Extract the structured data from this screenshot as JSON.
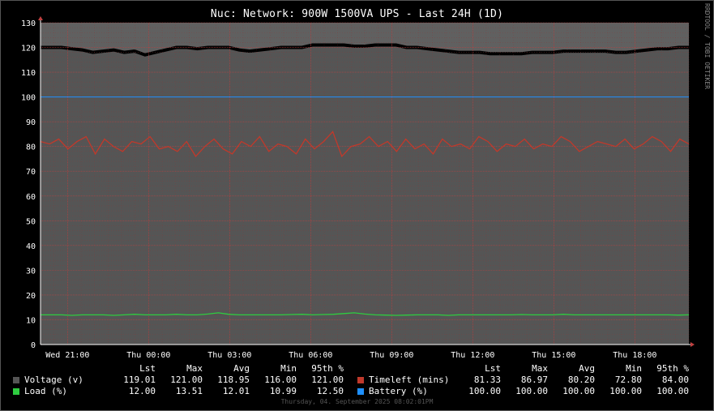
{
  "window": {
    "title": "Nuc: Network: 900W 1500VA UPS - Last 24H (1D)",
    "side_label": "RRDTOOL / TOBI OETIKER",
    "footer": "Thursday, 04. September 2025 08:02:01PM"
  },
  "colors": {
    "background": "#000000",
    "plot": "#606060",
    "grid": "#ff0000",
    "voltage": "#000000",
    "timeleft": "#c0392b",
    "load": "#2ecc40",
    "battery": "#1e90ff"
  },
  "chart_data": {
    "type": "line",
    "title": "Nuc: Network: 900W 1500VA UPS - Last 24H (1D)",
    "ylim": [
      0,
      130
    ],
    "yticks": [
      "0",
      "10",
      "20",
      "30",
      "40",
      "50",
      "60",
      "70",
      "80",
      "90",
      "100",
      "110",
      "120",
      "130"
    ],
    "xticks": [
      "Wed 21:00",
      "Thu 00:00",
      "Thu 03:00",
      "Thu 06:00",
      "Thu 09:00",
      "Thu 12:00",
      "Thu 15:00",
      "Thu 18:00"
    ],
    "x_hours": [
      1,
      4,
      7,
      10,
      13,
      16,
      19,
      22
    ],
    "grid": true,
    "legend": "bottom",
    "legend_headers": [
      "Lst",
      "Max",
      "Avg",
      "Min",
      "95th %"
    ],
    "series": [
      {
        "name": "Voltage (v)",
        "kind": "area",
        "color": "#555555",
        "stats": [
          "119.01",
          "121.00",
          "118.95",
          "116.00",
          "121.00"
        ],
        "values": [
          120,
          120,
          120,
          119.5,
          119,
          118,
          118.5,
          119,
          118,
          118.5,
          117,
          118,
          119,
          120,
          120,
          119.5,
          120,
          120,
          120,
          119,
          118.5,
          119,
          119.5,
          120,
          120,
          120,
          121,
          121,
          121,
          121,
          120.5,
          120.5,
          121,
          121,
          121,
          120,
          120,
          119.5,
          119,
          118.5,
          118,
          118,
          118,
          117.5,
          117.5,
          117.5,
          117.5,
          118,
          118,
          118,
          118.5,
          118.5,
          118.5,
          118.5,
          118.5,
          118,
          118,
          118.5,
          119,
          119.5,
          119.5,
          120,
          120
        ]
      },
      {
        "name": "Load (%)",
        "kind": "line",
        "color": "#2ecc40",
        "stats": [
          "12.00",
          "13.51",
          "12.01",
          "10.99",
          "12.50"
        ],
        "values": [
          12,
          12,
          12,
          11.8,
          12,
          12,
          12,
          11.8,
          12,
          12.2,
          12,
          12,
          12,
          12.2,
          12,
          12,
          12.3,
          12.8,
          12.2,
          12,
          12,
          12,
          12,
          12,
          12.1,
          12.2,
          12,
          12.1,
          12.2,
          12.5,
          12.8,
          12.3,
          12,
          11.9,
          11.8,
          11.9,
          12,
          12,
          12,
          11.8,
          12,
          12,
          12,
          12,
          12,
          12,
          12.1,
          12,
          12,
          12,
          12.2,
          12,
          12,
          12,
          12,
          12,
          12,
          12,
          12,
          12,
          12,
          11.9,
          12
        ]
      },
      {
        "name": "Timeleft (mins)",
        "kind": "line",
        "color": "#c0392b",
        "stats": [
          "81.33",
          "86.97",
          "80.20",
          "72.80",
          "84.00"
        ],
        "values": [
          82,
          81,
          83,
          79,
          82,
          84,
          77,
          83,
          80,
          78,
          82,
          81,
          84,
          79,
          80,
          78,
          82,
          76,
          80,
          83,
          79,
          77,
          82,
          80,
          84,
          78,
          81,
          80,
          77,
          83,
          79,
          82,
          86,
          76,
          80,
          81,
          84,
          80,
          82,
          78,
          83,
          79,
          81,
          77,
          83,
          80,
          81,
          79,
          84,
          82,
          78,
          81,
          80,
          83,
          79,
          81,
          80,
          84,
          82,
          78,
          80,
          82,
          81,
          80,
          83,
          79,
          81,
          84,
          82,
          78,
          83,
          81
        ]
      },
      {
        "name": "Battery (%)",
        "kind": "line",
        "color": "#1e90ff",
        "stats": [
          "100.00",
          "100.00",
          "100.00",
          "100.00",
          "100.00"
        ],
        "values": [
          100,
          100,
          100,
          100,
          100,
          100,
          100,
          100,
          100,
          100,
          100,
          100,
          100,
          100,
          100,
          100,
          100,
          100,
          100,
          100,
          100,
          100,
          100,
          100,
          100,
          100,
          100,
          100,
          100,
          100,
          100,
          100,
          100,
          100,
          100,
          100,
          100,
          100,
          100,
          100,
          100,
          100,
          100,
          100,
          100,
          100,
          100,
          100,
          100,
          100,
          100,
          100,
          100,
          100,
          100,
          100,
          100,
          100,
          100,
          100,
          100,
          100,
          100
        ]
      }
    ]
  }
}
